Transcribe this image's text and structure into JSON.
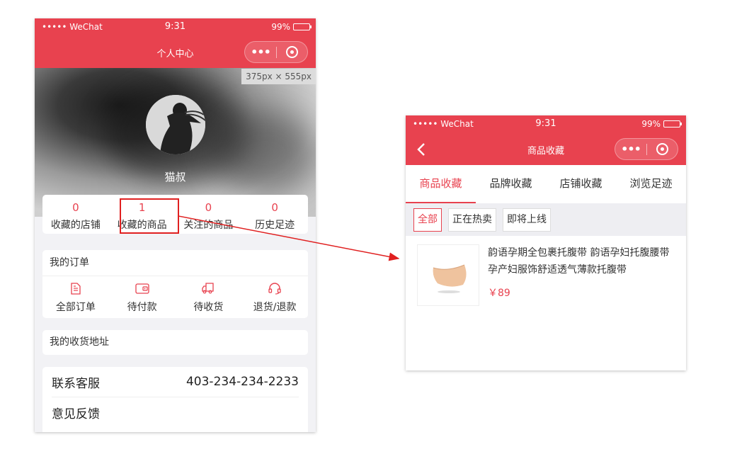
{
  "left_phone": {
    "status": {
      "carrier": "••••• WeChat",
      "time": "9:31",
      "battery": "99%"
    },
    "nav_title": "个人中心",
    "size_label": "375px × 555px",
    "username": "猫叔",
    "stats": [
      {
        "value": "0",
        "label": "收藏的店铺"
      },
      {
        "value": "1",
        "label": "收藏的商品"
      },
      {
        "value": "0",
        "label": "关注的商品"
      },
      {
        "value": "0",
        "label": "历史足迹"
      }
    ],
    "orders": {
      "heading": "我的订单",
      "items": [
        {
          "label": "全部订单",
          "icon": "document-icon"
        },
        {
          "label": "待付款",
          "icon": "wallet-icon"
        },
        {
          "label": "待收货",
          "icon": "truck-icon"
        },
        {
          "label": "退货/退款",
          "icon": "headset-icon"
        }
      ]
    },
    "address": "我的收货地址",
    "service": {
      "label": "联系客服",
      "phone": "403-234-234-2233"
    },
    "feedback": "意见反馈"
  },
  "right_phone": {
    "status": {
      "carrier": "••••• WeChat",
      "time": "9:31",
      "battery": "99%"
    },
    "nav_title": "商品收藏",
    "tabs": [
      "商品收藏",
      "品牌收藏",
      "店铺收藏",
      "浏览足迹"
    ],
    "filters": [
      "全部",
      "正在热卖",
      "即将上线"
    ],
    "product": {
      "title": "韵语孕期全包裹托腹带 韵语孕妇托腹腰带 孕产妇服饰舒适透气薄款托腹带",
      "price": "￥89"
    }
  },
  "colors": {
    "brand_red": "#e8424f",
    "highlight_red": "#e02020"
  }
}
